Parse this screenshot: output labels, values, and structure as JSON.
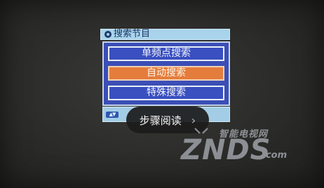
{
  "menu": {
    "title": "搜索节目",
    "items": [
      {
        "label": "单频点搜索",
        "selected": false
      },
      {
        "label": "自动搜索",
        "selected": true
      },
      {
        "label": "特殊搜索",
        "selected": false
      }
    ],
    "hint_icon": "up-down-arrows-icon"
  },
  "overlay": {
    "reader_label": "步骤阅读",
    "chevron_icon": "chevron-right-icon"
  },
  "watermark": {
    "small_text": "智能电视网",
    "main_text": "ZNDS",
    "suffix": ".com"
  },
  "colors": {
    "menu_bg": "#3b4eb6",
    "selected_bg": "#e47d3c",
    "title_bg": "#a9d4ec",
    "pill_bg": "#1c1c1c"
  }
}
